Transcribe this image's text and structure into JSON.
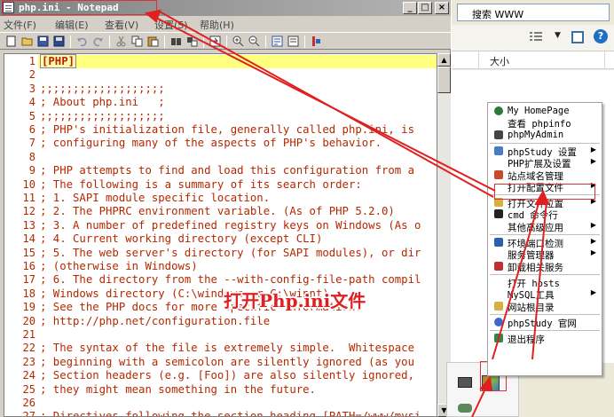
{
  "window": {
    "title": "php.ini - Notepad",
    "minimize_label": "_",
    "maximize_label": "□",
    "close_label": "×"
  },
  "menubar": [
    {
      "label": "文件(F)"
    },
    {
      "label": "编辑(E)"
    },
    {
      "label": "查看(V)"
    },
    {
      "label": "设置(S)"
    },
    {
      "label": "帮助(H)"
    }
  ],
  "editor": {
    "lines": [
      {
        "num": "1",
        "text": "[PHP]",
        "tag": true
      },
      {
        "num": "2",
        "text": ""
      },
      {
        "num": "3",
        "text": ";;;;;;;;;;;;;;;;;;;"
      },
      {
        "num": "4",
        "text": "; About php.ini   ;"
      },
      {
        "num": "5",
        "text": ";;;;;;;;;;;;;;;;;;;"
      },
      {
        "num": "6",
        "text": "; PHP's initialization file, generally called php.ini, is"
      },
      {
        "num": "7",
        "text": "; configuring many of the aspects of PHP's behavior."
      },
      {
        "num": "8",
        "text": ""
      },
      {
        "num": "9",
        "text": "; PHP attempts to find and load this configuration from a"
      },
      {
        "num": "10",
        "text": "; The following is a summary of its search order:"
      },
      {
        "num": "11",
        "text": "; 1. SAPI module specific location."
      },
      {
        "num": "12",
        "text": "; 2. The PHPRC environment variable. (As of PHP 5.2.0)"
      },
      {
        "num": "13",
        "text": "; 3. A number of predefined registry keys on Windows (As o"
      },
      {
        "num": "14",
        "text": "; 4. Current working directory (except CLI)"
      },
      {
        "num": "15",
        "text": "; 5. The web server's directory (for SAPI modules), or dir"
      },
      {
        "num": "16",
        "text": "; (otherwise in Windows)"
      },
      {
        "num": "17",
        "text": "; 6. The directory from the --with-config-file-path compil"
      },
      {
        "num": "18",
        "text": "; Windows directory (C:\\windows or C:\\winnt)"
      },
      {
        "num": "19",
        "text": "; See the PHP docs for more specific information."
      },
      {
        "num": "20",
        "text": "; http://php.net/configuration.file"
      },
      {
        "num": "21",
        "text": ""
      },
      {
        "num": "22",
        "text": "; The syntax of the file is extremely simple.  Whitespace"
      },
      {
        "num": "23",
        "text": "; beginning with a semicolon are silently ignored (as you"
      },
      {
        "num": "24",
        "text": "; Section headers (e.g. [Foo]) are also silently ignored,"
      },
      {
        "num": "25",
        "text": "; they might mean something in the future."
      },
      {
        "num": "26",
        "text": ""
      },
      {
        "num": "27",
        "text": "; Directives following the section heading [PATH=/www/mysi"
      }
    ]
  },
  "explorer": {
    "search_text": "搜索 WWW",
    "view_dropdown": "▼",
    "help_label": "?",
    "column_size": "大小"
  },
  "context_menu": {
    "items": [
      {
        "label": "My HomePage",
        "icon": "globe-icon"
      },
      {
        "label": "查看 phpinfo",
        "icon": ""
      },
      {
        "label": "phpMyAdmin",
        "icon": "db-icon"
      },
      {
        "sep": true
      },
      {
        "label": "phpStudy 设置",
        "icon": "gear-icon",
        "arrow": true
      },
      {
        "label": "PHP扩展及设置",
        "icon": "",
        "arrow": true
      },
      {
        "label": "站点域名管理",
        "icon": "site-icon"
      },
      {
        "label": "打开配置文件",
        "icon": "",
        "arrow": true
      },
      {
        "sep": true
      },
      {
        "label": "打开文件位置",
        "icon": "folder-icon",
        "arrow": true
      },
      {
        "label": "cmd 命令行",
        "icon": "cmd-icon"
      },
      {
        "label": "其他高级应用",
        "icon": "",
        "arrow": true
      },
      {
        "sep": true
      },
      {
        "label": "环境端口检测",
        "icon": "check-icon",
        "arrow": true
      },
      {
        "label": "服务管理器",
        "icon": "",
        "arrow": true
      },
      {
        "label": "卸载相关服务",
        "icon": "uninstall-icon"
      },
      {
        "sep": true
      },
      {
        "label": "打开 hosts",
        "icon": ""
      },
      {
        "label": "MySQL工具",
        "icon": "",
        "arrow": true
      },
      {
        "label": "网站根目录",
        "icon": "folder-icon"
      },
      {
        "sep": true
      },
      {
        "label": "phpStudy 官网",
        "icon": "home-icon"
      },
      {
        "sep": true
      },
      {
        "label": "退出程序",
        "icon": "exit-icon"
      }
    ]
  },
  "annotation": {
    "callout_text": "打开Php.ini文件",
    "color": "#e02020"
  },
  "colors": {
    "code_text": "#b42800",
    "current_line": "#ffff80",
    "highlight_box": "#e03030"
  }
}
